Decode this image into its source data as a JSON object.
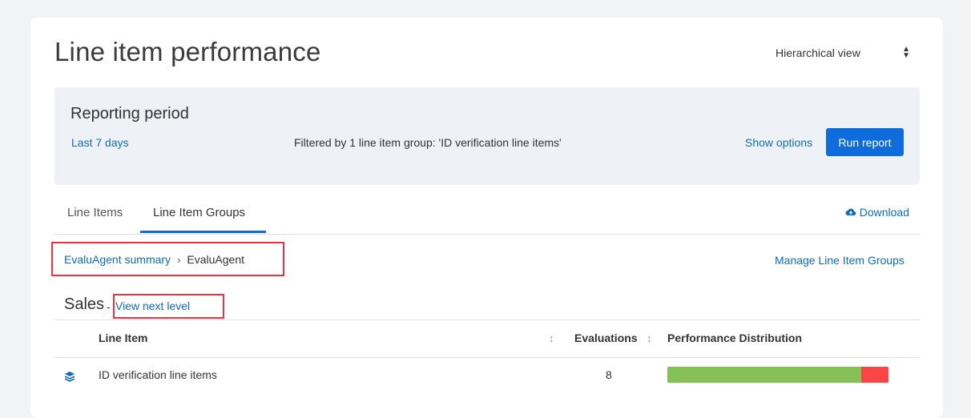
{
  "page": {
    "title": "Line item performance"
  },
  "view_select": {
    "value": "Hierarchical view"
  },
  "reporting": {
    "title": "Reporting period",
    "period_link": "Last 7 days",
    "filter_text": "Filtered by 1 line item group: 'ID verification line items'",
    "show_options": "Show options",
    "run_report": "Run report"
  },
  "tabs": [
    {
      "label": "Line Items",
      "active": false
    },
    {
      "label": "Line Item Groups",
      "active": true
    }
  ],
  "download": {
    "label": "Download",
    "icon": "cloud-upload-icon"
  },
  "breadcrumb": {
    "parent": "EvaluAgent summary",
    "separator": "›",
    "current": "EvaluAgent"
  },
  "manage_link": "Manage Line Item Groups",
  "section": {
    "title": "Sales",
    "dash": "-",
    "next_level": "View next level"
  },
  "table": {
    "columns": {
      "line_item": "Line Item",
      "evaluations": "Evaluations",
      "performance": "Performance Distribution"
    },
    "rows": [
      {
        "icon": "layers-icon",
        "name": "ID verification line items",
        "evaluations": "8",
        "performance": {
          "good_fraction": 0.875,
          "bad_fraction": 0.125
        }
      }
    ]
  },
  "colors": {
    "accent": "#0f6cdc",
    "link": "#0f6cbd",
    "good": "#86c155",
    "bad": "#fa4545",
    "highlight": "#e8343f"
  }
}
